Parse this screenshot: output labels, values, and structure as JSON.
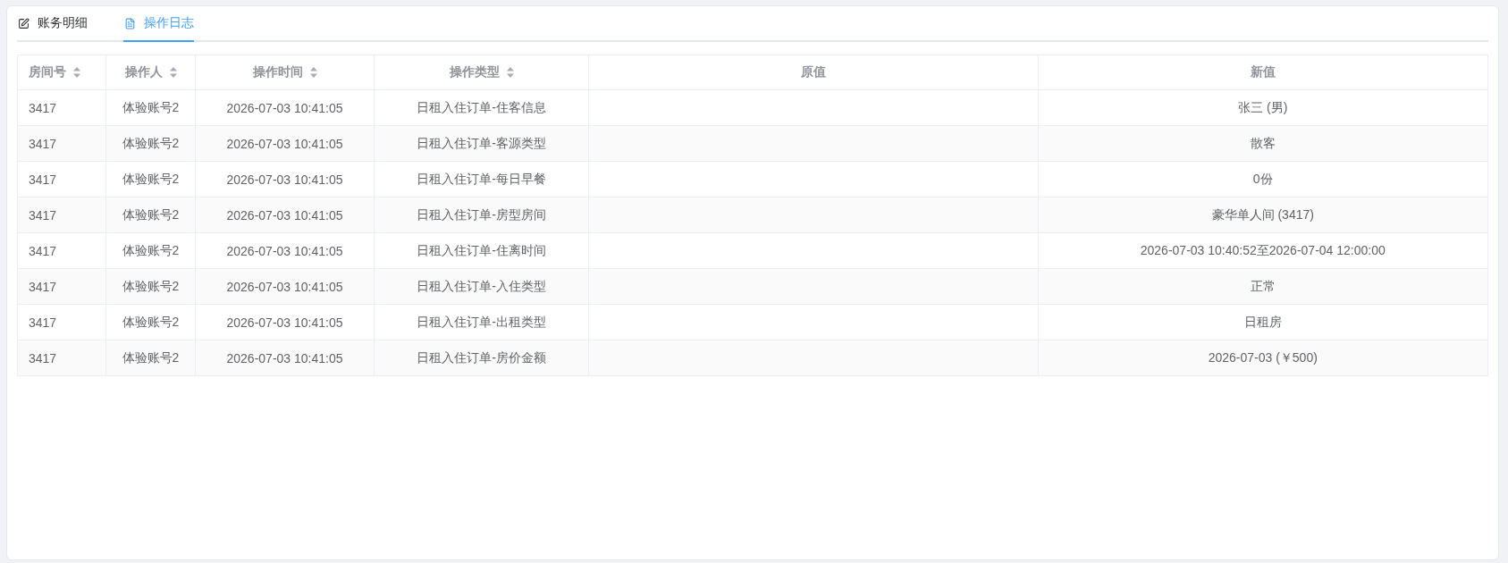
{
  "tabs": [
    {
      "label": "账务明细",
      "kind": "edit",
      "selected": false
    },
    {
      "label": "操作日志",
      "kind": "document",
      "selected": true
    }
  ],
  "table": {
    "columns": [
      {
        "label": "房间号",
        "sortable": true
      },
      {
        "label": "操作人",
        "sortable": true
      },
      {
        "label": "操作时间",
        "sortable": true
      },
      {
        "label": "操作类型",
        "sortable": true
      },
      {
        "label": "原值",
        "sortable": false
      },
      {
        "label": "新值",
        "sortable": false
      }
    ],
    "rows": [
      {
        "room": "3417",
        "operator": "体验账号2",
        "time": "2026-07-03 10:41:05",
        "type": "日租入住订单-住客信息",
        "new_value": "张三 (男)"
      },
      {
        "room": "3417",
        "operator": "体验账号2",
        "time": "2026-07-03 10:41:05",
        "type": "日租入住订单-客源类型",
        "new_value": "散客"
      },
      {
        "room": "3417",
        "operator": "体验账号2",
        "time": "2026-07-03 10:41:05",
        "type": "日租入住订单-每日早餐",
        "new_value": "0份"
      },
      {
        "room": "3417",
        "operator": "体验账号2",
        "time": "2026-07-03 10:41:05",
        "type": "日租入住订单-房型房间",
        "new_value": "豪华单人间 (3417)"
      },
      {
        "room": "3417",
        "operator": "体验账号2",
        "time": "2026-07-03 10:41:05",
        "type": "日租入住订单-住离时间",
        "new_value": "2026-07-03 10:40:52至2026-07-04 12:00:00"
      },
      {
        "room": "3417",
        "operator": "体验账号2",
        "time": "2026-07-03 10:41:05",
        "type": "日租入住订单-入住类型",
        "new_value": "正常"
      },
      {
        "room": "3417",
        "operator": "体验账号2",
        "time": "2026-07-03 10:41:05",
        "type": "日租入住订单-出租类型",
        "new_value": "日租房"
      },
      {
        "room": "3417",
        "operator": "体验账号2",
        "time": "2026-07-03 10:41:05",
        "type": "日租入住订单-房价金额",
        "new_value": "2026-07-03 (￥500)"
      }
    ]
  }
}
